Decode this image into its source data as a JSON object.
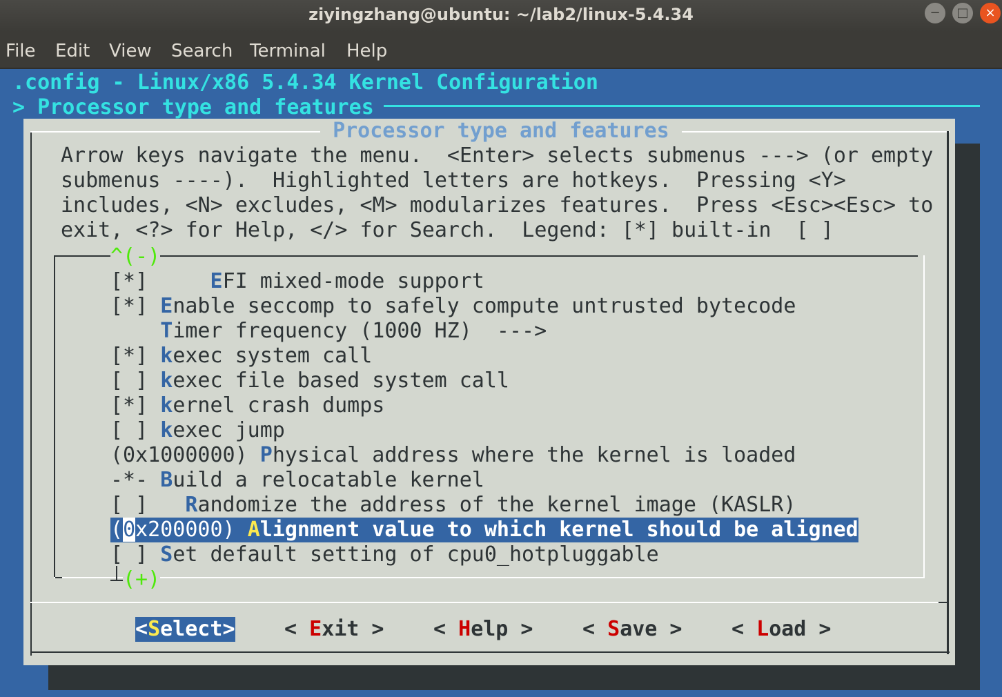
{
  "window": {
    "title": "ziyingzhang@ubuntu: ~/lab2/linux-5.4.34",
    "controls": {
      "minimize": "−",
      "maximize": "□",
      "close": "×"
    }
  },
  "menubar": [
    "File",
    "Edit",
    "View",
    "Search",
    "Terminal",
    "Help"
  ],
  "header": {
    "config_title": ".config - Linux/x86 5.4.34 Kernel Configuration",
    "breadcrumb": "> Processor type and features"
  },
  "dialog": {
    "title": "Processor type and features",
    "help_lines": [
      "Arrow keys navigate the menu.  <Enter> selects submenus ---> (or empty",
      "submenus ----).  Highlighted letters are hotkeys.  Pressing <Y>",
      "includes, <N> excludes, <M> modularizes features.  Press <Esc><Esc> to",
      "exit, <?> for Help, </> for Search.  Legend: [*] built-in  [ ]"
    ],
    "scroll_up": "^(-)",
    "scroll_down": "(+)",
    "items": [
      {
        "prefix": "[*]     ",
        "hot": "E",
        "rest": "FI mixed-mode support"
      },
      {
        "prefix": "[*] ",
        "hot": "E",
        "rest": "nable seccomp to safely compute untrusted bytecode"
      },
      {
        "prefix": "    ",
        "hot": "T",
        "rest": "imer frequency (1000 HZ)  --->"
      },
      {
        "prefix": "[*] ",
        "hot": "k",
        "rest": "exec system call"
      },
      {
        "prefix": "[ ] ",
        "hot": "k",
        "rest": "exec file based system call"
      },
      {
        "prefix": "[*] ",
        "hot": "k",
        "rest": "ernel crash dumps"
      },
      {
        "prefix": "[ ] ",
        "hot": "k",
        "rest": "exec jump"
      },
      {
        "prefix": "(0x1000000) ",
        "hot": "P",
        "rest": "hysical address where the kernel is loaded"
      },
      {
        "prefix": "-*- ",
        "hot": "B",
        "rest": "uild a relocatable kernel"
      },
      {
        "prefix": "[ ]   ",
        "hot": "R",
        "rest": "andomize the address of the kernel image (KASLR)"
      },
      {
        "prefix_a": "(",
        "cursor": "0",
        "prefix_b": "x200000) ",
        "hot": "A",
        "rest": "lignment value to which kernel should be aligned",
        "selected": true
      },
      {
        "prefix": "[ ] ",
        "hot": "S",
        "rest": "et default setting of cpu0_hotpluggable"
      }
    ],
    "buttons": [
      {
        "open": "<",
        "hot": "S",
        "rest": "elect",
        "close": ">",
        "selected": true
      },
      {
        "open": "< ",
        "hot": "E",
        "rest": "xit",
        "close": " >"
      },
      {
        "open": "< ",
        "hot": "H",
        "rest": "elp",
        "close": " >"
      },
      {
        "open": "< ",
        "hot": "S",
        "rest": "ave",
        "close": " >"
      },
      {
        "open": "< ",
        "hot": "L",
        "rest": "oad",
        "close": " >"
      }
    ]
  }
}
